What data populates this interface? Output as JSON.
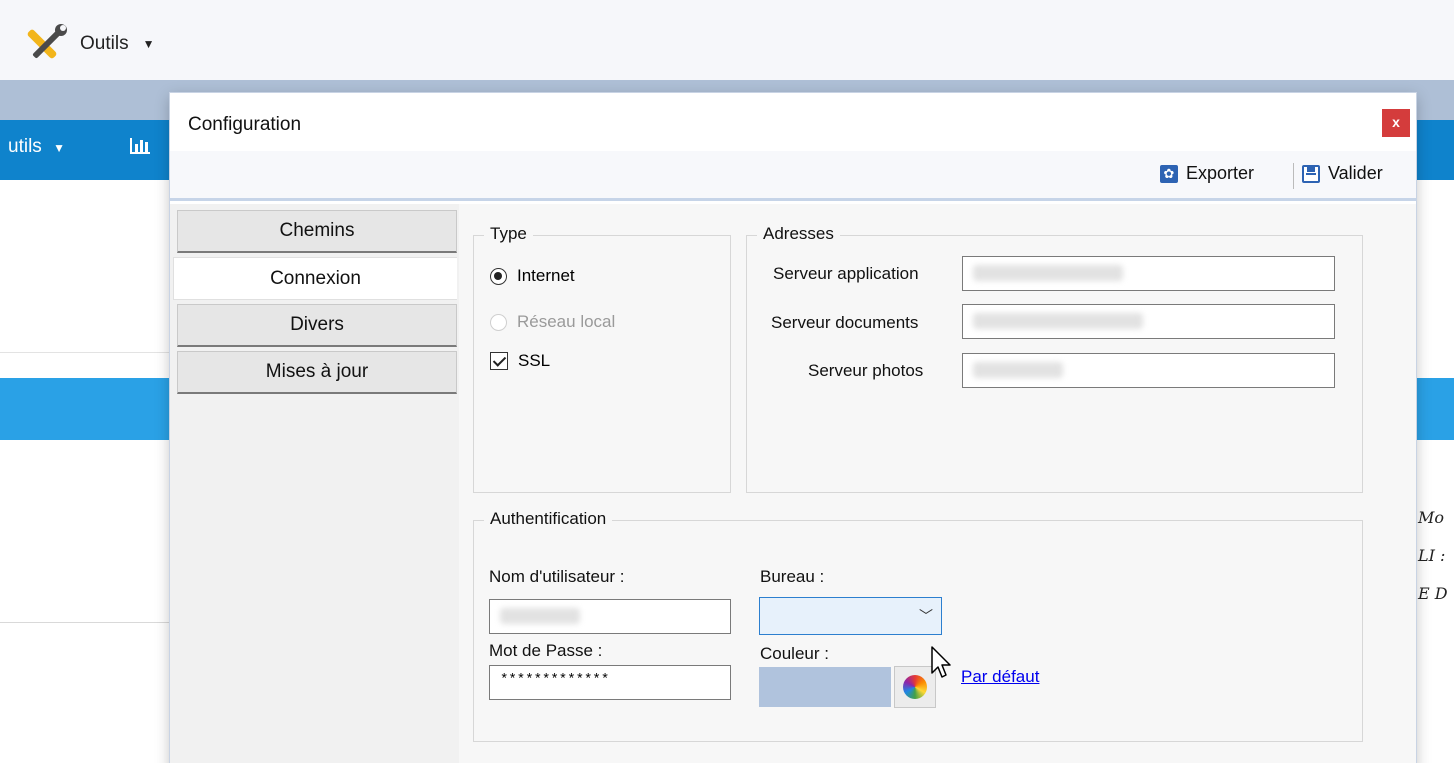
{
  "background": {
    "tools_label": "Outils",
    "nav_label": "utils",
    "side_texts": [
      "Mo",
      "LI :",
      "E D"
    ]
  },
  "dialog": {
    "title": "Configuration",
    "close_label": "x",
    "toolbar": {
      "export_label": "Exporter",
      "validate_label": "Valider"
    },
    "tabs": [
      {
        "label": "Chemins",
        "active": false
      },
      {
        "label": "Connexion",
        "active": true
      },
      {
        "label": "Divers",
        "active": false
      },
      {
        "label": "Mises à jour",
        "active": false
      }
    ],
    "type_group": {
      "title": "Type",
      "options": [
        {
          "label": "Internet",
          "checked": true,
          "enabled": true
        },
        {
          "label": "Réseau local",
          "checked": false,
          "enabled": false
        }
      ],
      "ssl": {
        "label": "SSL",
        "checked": true
      }
    },
    "addresses_group": {
      "title": "Adresses",
      "fields": [
        {
          "label": "Serveur application",
          "value": ""
        },
        {
          "label": "Serveur documents",
          "value": ""
        },
        {
          "label": "Serveur photos",
          "value": ""
        }
      ]
    },
    "auth_group": {
      "title": "Authentification",
      "username_label": "Nom d'utilisateur :",
      "username_value": "",
      "password_label": "Mot de Passe :",
      "password_value": "*************",
      "office_label": "Bureau :",
      "office_value": "",
      "color_label": "Couleur :",
      "color_value": "#b0c3dd",
      "default_link": "Par défaut"
    }
  },
  "colors": {
    "accent_blue": "#0f83cc",
    "band_blue": "#2aa1e6",
    "close_red": "#d43c3c",
    "link_blue": "#0000ee"
  }
}
